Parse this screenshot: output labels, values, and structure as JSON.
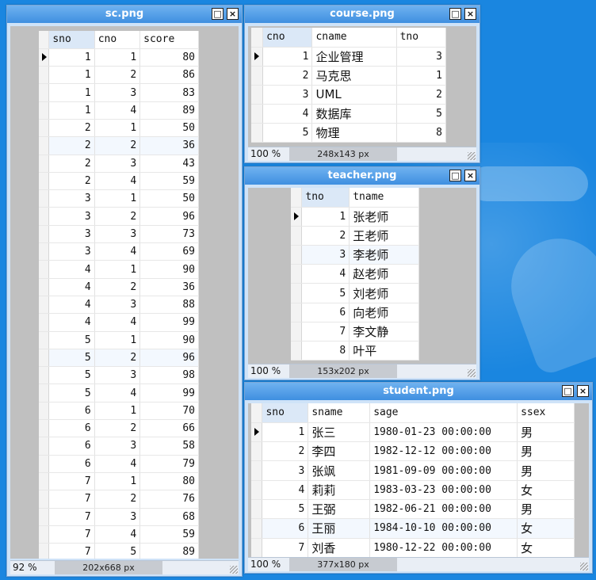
{
  "windows": {
    "sc": {
      "title": "sc.png",
      "zoom": "92 %",
      "dims": "202x668 px",
      "columns": [
        "sno",
        "cno",
        "score"
      ],
      "rows": [
        [
          "1",
          "1",
          "80"
        ],
        [
          "1",
          "2",
          "86"
        ],
        [
          "1",
          "3",
          "83"
        ],
        [
          "1",
          "4",
          "89"
        ],
        [
          "2",
          "1",
          "50"
        ],
        [
          "2",
          "2",
          "36"
        ],
        [
          "2",
          "3",
          "43"
        ],
        [
          "2",
          "4",
          "59"
        ],
        [
          "3",
          "1",
          "50"
        ],
        [
          "3",
          "2",
          "96"
        ],
        [
          "3",
          "3",
          "73"
        ],
        [
          "3",
          "4",
          "69"
        ],
        [
          "4",
          "1",
          "90"
        ],
        [
          "4",
          "2",
          "36"
        ],
        [
          "4",
          "3",
          "88"
        ],
        [
          "4",
          "4",
          "99"
        ],
        [
          "5",
          "1",
          "90"
        ],
        [
          "5",
          "2",
          "96"
        ],
        [
          "5",
          "3",
          "98"
        ],
        [
          "5",
          "4",
          "99"
        ],
        [
          "6",
          "1",
          "70"
        ],
        [
          "6",
          "2",
          "66"
        ],
        [
          "6",
          "3",
          "58"
        ],
        [
          "6",
          "4",
          "79"
        ],
        [
          "7",
          "1",
          "80"
        ],
        [
          "7",
          "2",
          "76"
        ],
        [
          "7",
          "3",
          "68"
        ],
        [
          "7",
          "4",
          "59"
        ],
        [
          "7",
          "5",
          "89"
        ]
      ]
    },
    "course": {
      "title": "course.png",
      "zoom": "100 %",
      "dims": "248x143 px",
      "columns": [
        "cno",
        "cname",
        "tno"
      ],
      "rows": [
        [
          "1",
          "企业管理",
          "3"
        ],
        [
          "2",
          "马克思",
          "1"
        ],
        [
          "3",
          "UML",
          "2"
        ],
        [
          "4",
          "数据库",
          "5"
        ],
        [
          "5",
          "物理",
          "8"
        ]
      ]
    },
    "teacher": {
      "title": "teacher.png",
      "zoom": "100 %",
      "dims": "153x202 px",
      "columns": [
        "tno",
        "tname"
      ],
      "rows": [
        [
          "1",
          "张老师"
        ],
        [
          "2",
          "王老师"
        ],
        [
          "3",
          "李老师"
        ],
        [
          "4",
          "赵老师"
        ],
        [
          "5",
          "刘老师"
        ],
        [
          "6",
          "向老师"
        ],
        [
          "7",
          "李文静"
        ],
        [
          "8",
          "叶平"
        ]
      ]
    },
    "student": {
      "title": "student.png",
      "zoom": "100 %",
      "dims": "377x180 px",
      "columns": [
        "sno",
        "sname",
        "sage",
        "ssex"
      ],
      "rows": [
        [
          "1",
          "张三",
          "1980-01-23 00:00:00",
          "男"
        ],
        [
          "2",
          "李四",
          "1982-12-12 00:00:00",
          "男"
        ],
        [
          "3",
          "张飒",
          "1981-09-09 00:00:00",
          "男"
        ],
        [
          "4",
          "莉莉",
          "1983-03-23 00:00:00",
          "女"
        ],
        [
          "5",
          "王弼",
          "1982-06-21 00:00:00",
          "男"
        ],
        [
          "6",
          "王丽",
          "1984-10-10 00:00:00",
          "女"
        ],
        [
          "7",
          "刘香",
          "1980-12-22 00:00:00",
          "女"
        ]
      ]
    }
  },
  "window_buttons": {
    "maximize": "□",
    "close": "×"
  }
}
